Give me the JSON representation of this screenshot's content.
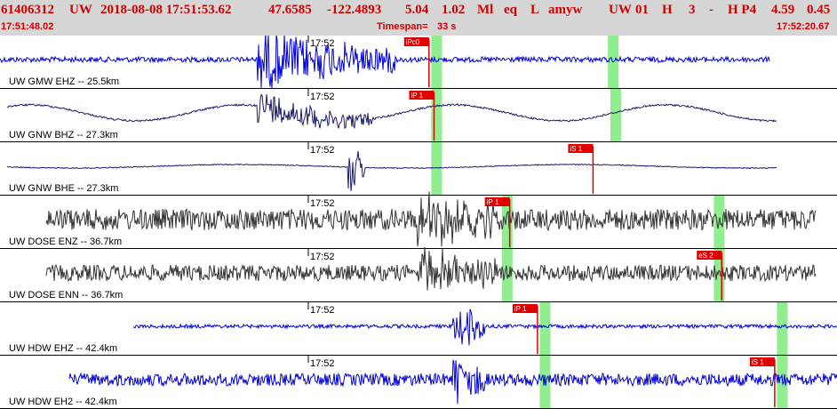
{
  "header": {
    "event_id": "61406312",
    "network": "UW",
    "datetime": "2018-08-08 17:51:53.62",
    "latitude": "47.6585",
    "longitude": "-122.4893",
    "depth": "5.04",
    "magnitude": "1.02",
    "mag_type": "Ml",
    "event_type": "eq",
    "status": "L",
    "author": "amyw",
    "version_source": "UW",
    "version": "01",
    "quality_flag": "H",
    "phase_count": "3",
    "dash": "-",
    "solution_type": "H P4",
    "rms": "4.59",
    "error": "0.45",
    "start_time": "17:51:48.02",
    "timespan_label": "Timespan=",
    "timespan_value": "33 s",
    "end_time": "17:52:20.67"
  },
  "colors": {
    "header_bg": "#d6d6d6",
    "header_text": "#d00000",
    "trace_blue": "#0000dd",
    "trace_navy": "#1a1a6e",
    "trace_gray": "#333333",
    "pick_box": "#e00000",
    "pick_window": "#90ee90"
  },
  "minute_marker": "17:52",
  "channels": [
    {
      "label": "UW GMW EHZ -- 25.5km",
      "color": "blue",
      "picks": [
        {
          "label": "iPc0",
          "time_s": 17.0
        }
      ],
      "windows_s": [
        17.3,
        24.3
      ]
    },
    {
      "label": "UW GNW BHZ -- 27.3km",
      "color": "navy",
      "picks": [
        {
          "label": "iP  1",
          "time_s": 17.2
        }
      ],
      "windows_s": [
        17.3,
        24.4
      ]
    },
    {
      "label": "UW GNW BHE -- 27.3km",
      "color": "navy",
      "picks": [
        {
          "label": "iS  1",
          "time_s": 23.5
        }
      ],
      "windows_s": [
        17.3
      ]
    },
    {
      "label": "UW DOSE ENZ -- 36.7km",
      "color": "gray",
      "picks": [
        {
          "label": "iP  1",
          "time_s": 20.2
        }
      ],
      "windows_s": [
        20.1,
        28.5
      ]
    },
    {
      "label": "UW DOSE ENN -- 36.7km",
      "color": "gray",
      "picks": [
        {
          "label": "eS  2",
          "time_s": 28.6
        }
      ],
      "windows_s": [
        20.1,
        28.5
      ]
    },
    {
      "label": "UW HDW EHZ -- 42.4km",
      "color": "blue",
      "picks": [
        {
          "label": "iP  1",
          "time_s": 21.3
        }
      ],
      "windows_s": [
        21.6,
        31.0
      ]
    },
    {
      "label": "UW HDW EH2 -- 42.4km",
      "color": "blue",
      "picks": [
        {
          "label": "iS  1",
          "time_s": 30.7
        }
      ],
      "windows_s": [
        21.6,
        31.0
      ]
    }
  ]
}
